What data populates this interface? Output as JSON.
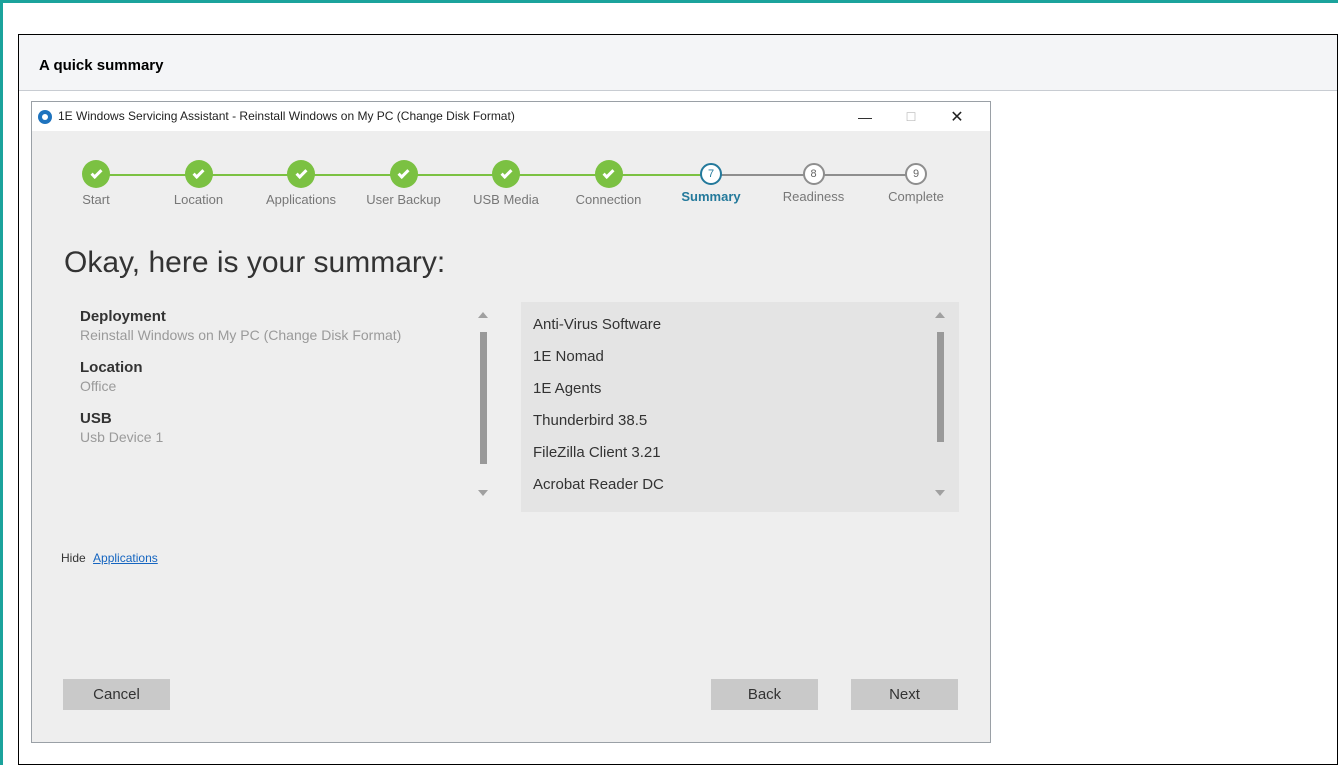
{
  "page": {
    "title": "A quick summary",
    "accent_color": "#1ba39c"
  },
  "window": {
    "title": "1E Windows Servicing Assistant - Reinstall Windows on My PC (Change Disk Format)",
    "minimize_icon": "minimize-icon",
    "maximize_icon": "maximize-icon",
    "close_icon": "close-icon"
  },
  "stepper": {
    "done_color": "#7bc142",
    "current_color": "#23799b",
    "steps": [
      {
        "label": "Start",
        "state": "done",
        "number": "1"
      },
      {
        "label": "Location",
        "state": "done",
        "number": "2"
      },
      {
        "label": "Applications",
        "state": "done",
        "number": "3"
      },
      {
        "label": "User Backup",
        "state": "done",
        "number": "4"
      },
      {
        "label": "USB Media",
        "state": "done",
        "number": "5"
      },
      {
        "label": "Connection",
        "state": "done",
        "number": "6"
      },
      {
        "label": "Summary",
        "state": "current",
        "number": "7"
      },
      {
        "label": "Readiness",
        "state": "pending",
        "number": "8"
      },
      {
        "label": "Complete",
        "state": "pending",
        "number": "9"
      }
    ]
  },
  "main": {
    "heading": "Okay, here is your summary:",
    "summary": [
      {
        "label": "Deployment",
        "value": "Reinstall Windows on My PC (Change Disk Format)"
      },
      {
        "label": "Location",
        "value": "Office"
      },
      {
        "label": "USB",
        "value": "Usb Device 1"
      }
    ],
    "applications": [
      "Anti-Virus Software",
      "1E Nomad",
      "1E Agents",
      "Thunderbird 38.5",
      "FileZilla Client 3.21",
      "Acrobat Reader DC"
    ],
    "hide_text": "Hide",
    "hide_link": "Applications"
  },
  "buttons": {
    "cancel": "Cancel",
    "back": "Back",
    "next": "Next"
  }
}
